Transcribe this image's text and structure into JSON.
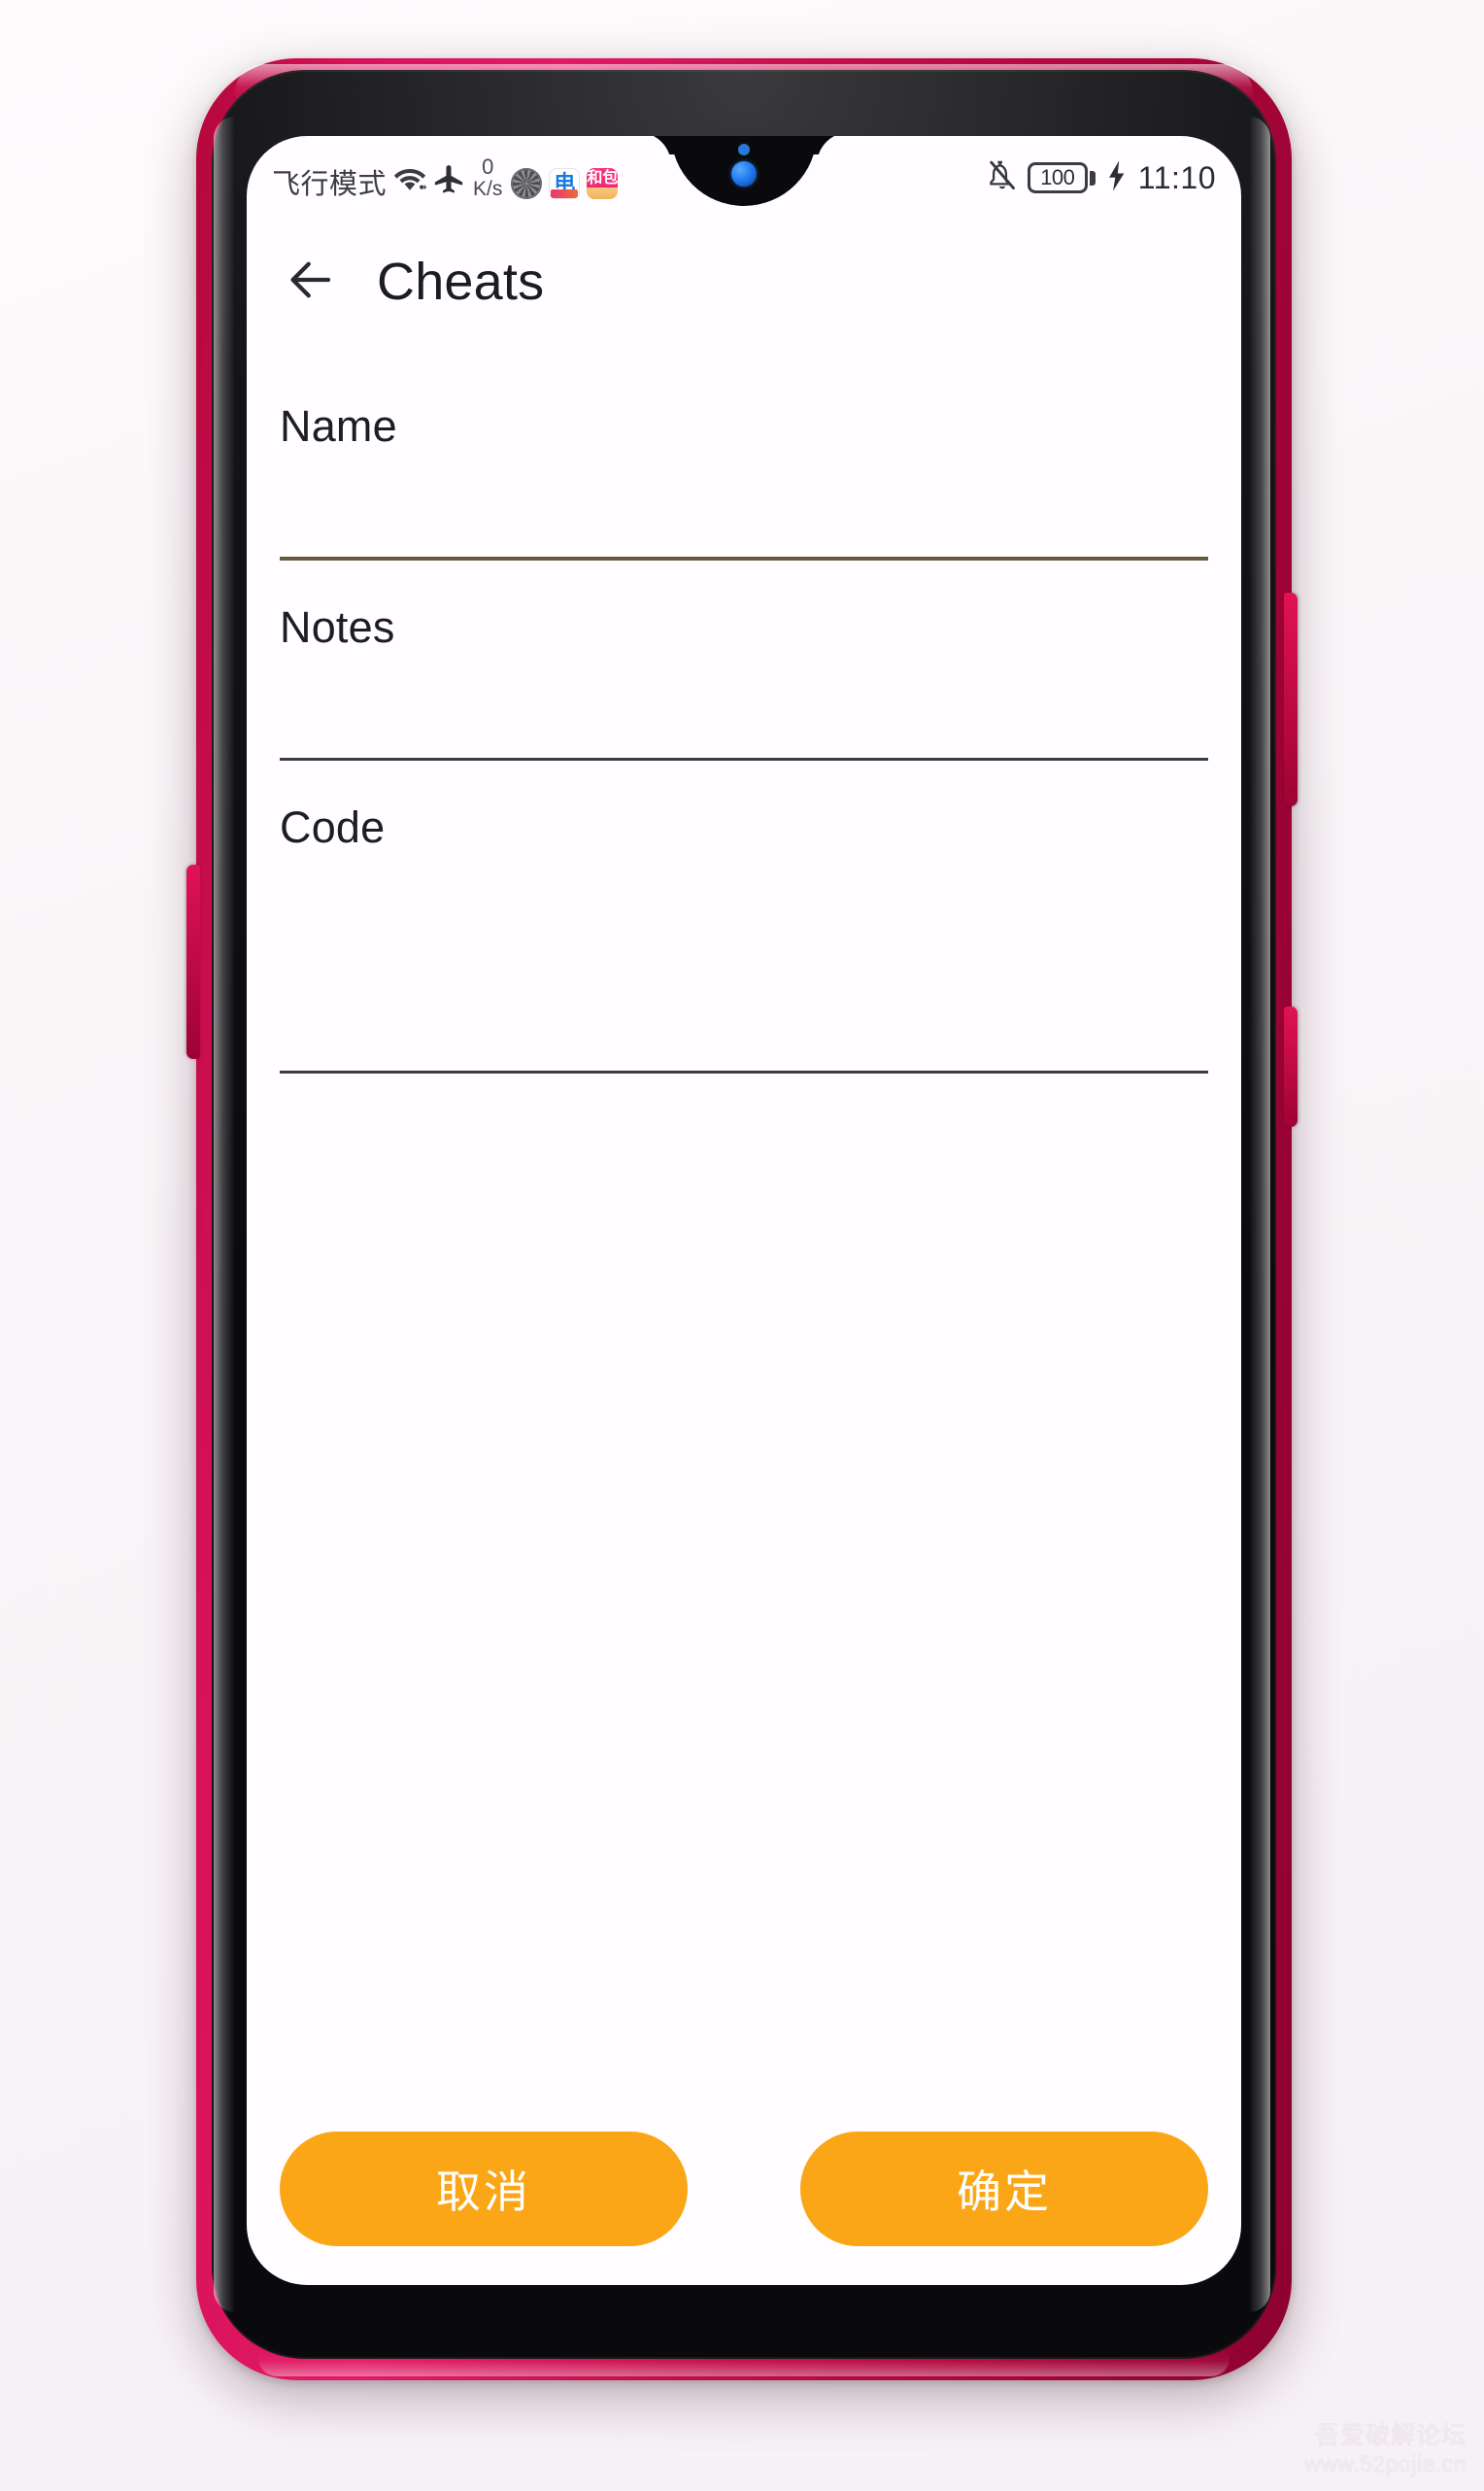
{
  "statusbar": {
    "network_label": "飞行模式",
    "wifi_icon": "wifi-icon",
    "airplane_icon": "airplane-mode-icon",
    "speed_value": "0",
    "speed_unit": "K/s",
    "app_icons": [
      {
        "name": "sports-ball-app-icon",
        "glyph": ""
      },
      {
        "name": "china-telecom-app-icon",
        "glyph": "电"
      },
      {
        "name": "he-bao-wallet-app-icon",
        "glyph": "和包"
      }
    ],
    "silent_icon": "bell-off-icon",
    "battery_percent": "100",
    "charging_icon": "charging-bolt-icon",
    "clock": "11:10"
  },
  "appbar": {
    "back_icon": "back-arrow-icon",
    "title": "Cheats"
  },
  "form": {
    "fields": [
      {
        "name": "name",
        "label": "Name",
        "value": "",
        "placeholder": "",
        "focused": true
      },
      {
        "name": "notes",
        "label": "Notes",
        "value": "",
        "placeholder": "",
        "focused": false
      },
      {
        "name": "code",
        "label": "Code",
        "value": "",
        "placeholder": "",
        "focused": false
      }
    ]
  },
  "actions": {
    "cancel_label": "取消",
    "confirm_label": "确定"
  },
  "watermark": {
    "title": "吾爱破解论坛",
    "url": "www.52pojie.cn"
  },
  "colors": {
    "accent_button": "#fba616",
    "focused_underline": "#675a3f",
    "idle_underline": "#3a3a40",
    "phone_body": "#c20d49",
    "screen_bg": "#fffdff",
    "page_bg": "#faf6f8"
  }
}
